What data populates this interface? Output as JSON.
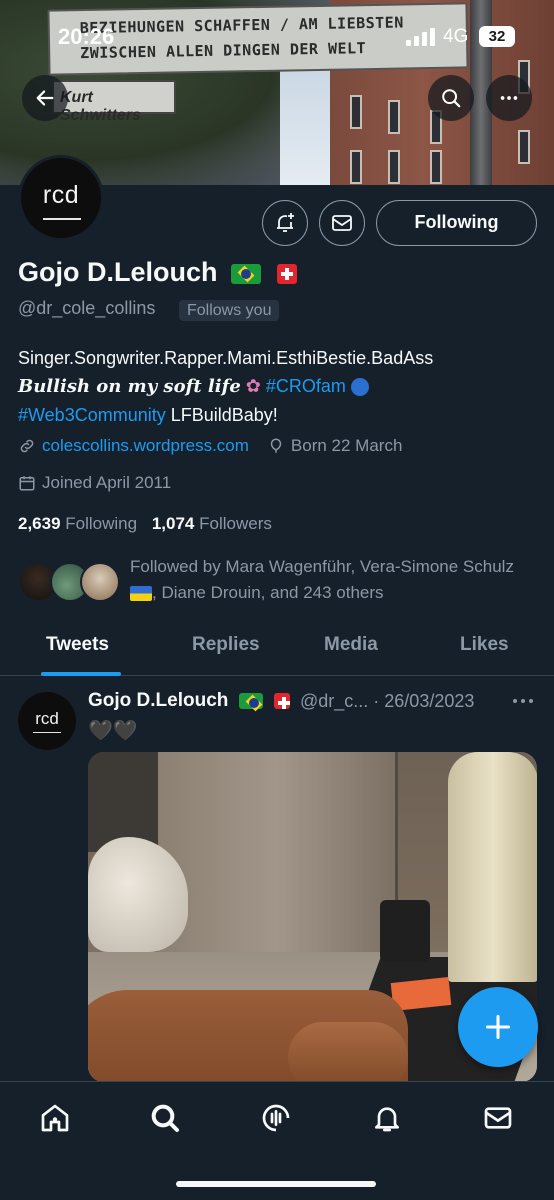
{
  "status_bar": {
    "time": "20:26",
    "network": "4G",
    "battery": "32"
  },
  "banner": {
    "sign_line1": "BEZIEHUNGEN SCHAFFEN / AM LIEBSTEN",
    "sign_line2": "ZWISCHEN ALLEN DINGEN DER WELT",
    "sign_small": "Kurt Schwitters"
  },
  "header": {
    "back_icon": "arrow-left-icon",
    "search_icon": "search-icon",
    "more_icon": "more-horizontal-icon"
  },
  "profile": {
    "avatar_text": "rcd",
    "notify_icon": "bell-plus-icon",
    "message_icon": "envelope-icon",
    "following_label": "Following",
    "name": "Gojo D.Lelouch",
    "handle": "@dr_cole_collins",
    "follows_you": "Follows you",
    "bio_line1": "Singer.Songwriter.Rapper.Mami.EsthiBestie.BadAss",
    "bio_gothic": "Bullish on my soft life",
    "bio_hashtag1": "#CROfam",
    "bio_hashtag2": "#Web3Community",
    "bio_tail": "LFBuildBaby!",
    "website": "colescollins.wordpress.com",
    "born": "Born 22 March",
    "joined": "Joined April 2011",
    "following_count": "2,639",
    "following_text": "Following",
    "followers_count": "1,074",
    "followers_text": "Followers",
    "followed_by_1": "Followed by Mara Wagenführ, Vera-Simone Schulz",
    "followed_by_2": ", Diane Drouin, and 243 others"
  },
  "tabs": [
    {
      "label": "Tweets",
      "active": true
    },
    {
      "label": "Replies",
      "active": false
    },
    {
      "label": "Media",
      "active": false
    },
    {
      "label": "Likes",
      "active": false
    }
  ],
  "tweet": {
    "avatar_text": "rcd",
    "name": "Gojo D.Lelouch",
    "handle_date": "@dr_c... · 26/03/2023",
    "text": "🖤🖤"
  },
  "fab_icon": "plus-icon",
  "bottom_nav": [
    "home-icon",
    "search-icon",
    "spaces-icon",
    "notifications-icon",
    "messages-icon"
  ],
  "colors": {
    "background": "#15202b",
    "accent": "#1d9bf0",
    "secondary_text": "#8b98a5",
    "border": "#38444d"
  }
}
